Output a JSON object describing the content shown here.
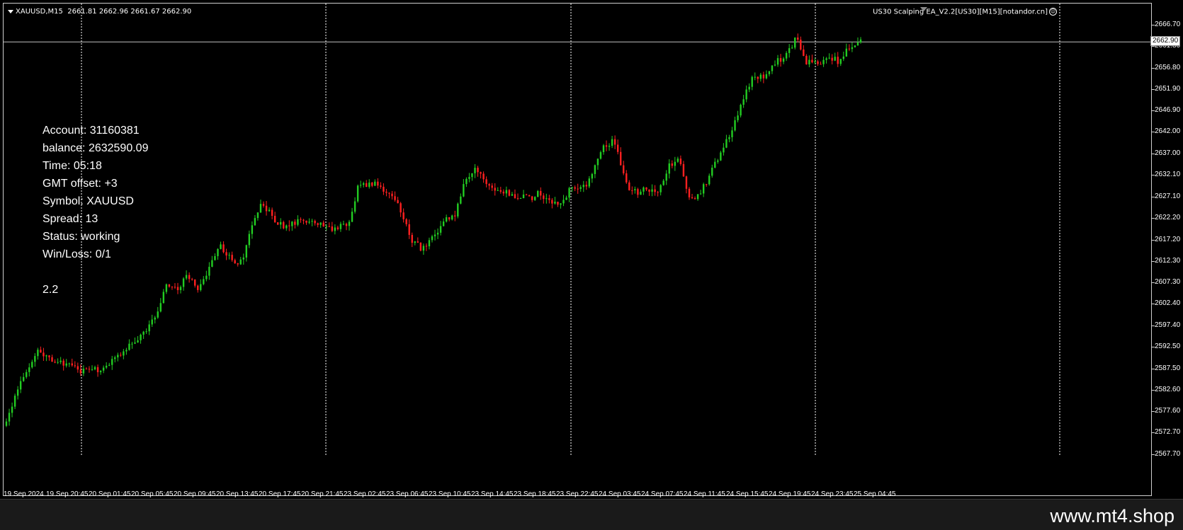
{
  "header": {
    "symbol_tf": "XAUUSD,M15",
    "ohlc": "2661.81 2662.96 2661.67 2662.90"
  },
  "ea": {
    "label": "US30 Scalping EA_V2.2[US30][M15][notandor.cn]",
    "icon": "smiley-icon"
  },
  "info_panel": {
    "lines": [
      "Account: 31160381",
      "balance: 2632590.09",
      "Time: 05:18",
      "GMT offset: +3",
      "Symbol: XAUUSD",
      "Spread: 13",
      "Status: working",
      "Win/Loss: 0/1"
    ],
    "version": "2.2"
  },
  "price_axis": {
    "labels": [
      "2666.70",
      "2661.80",
      "2656.80",
      "2651.90",
      "2646.90",
      "2642.00",
      "2637.00",
      "2632.10",
      "2627.10",
      "2622.20",
      "2617.20",
      "2612.30",
      "2607.30",
      "2602.40",
      "2597.40",
      "2592.50",
      "2587.50",
      "2582.60",
      "2577.60",
      "2572.70",
      "2567.70"
    ],
    "current": "2662.90"
  },
  "time_axis": {
    "labels": [
      "19 Sep 2024",
      "19 Sep 20:45",
      "20 Sep 01:45",
      "20 Sep 05:45",
      "20 Sep 09:45",
      "20 Sep 13:45",
      "20 Sep 17:45",
      "20 Sep 21:45",
      "23 Sep 02:45",
      "23 Sep 06:45",
      "23 Sep 10:45",
      "23 Sep 14:45",
      "23 Sep 18:45",
      "23 Sep 22:45",
      "24 Sep 03:45",
      "24 Sep 07:45",
      "24 Sep 11:45",
      "24 Sep 15:45",
      "24 Sep 19:45",
      "24 Sep 23:45",
      "25 Sep 04:45"
    ]
  },
  "watermark": "www.mt4.shop",
  "colors": {
    "background": "#000000",
    "bull": "#22cc22",
    "bear": "#ff2020",
    "grid": "#ffffff",
    "bid_line": "#bfbfbf"
  },
  "chart_data": {
    "type": "candlestick",
    "symbol": "XAUUSD",
    "timeframe": "M15",
    "ylim": [
      2567.7,
      2666.7
    ],
    "y_ticks": [
      2666.7,
      2661.8,
      2656.8,
      2651.9,
      2646.9,
      2642.0,
      2637.0,
      2632.1,
      2627.1,
      2622.2,
      2617.2,
      2612.3,
      2607.3,
      2602.4,
      2597.4,
      2592.5,
      2587.5,
      2582.6,
      2577.6,
      2572.7,
      2567.7
    ],
    "bid": 2662.9,
    "close_path": [
      2575,
      2583,
      2588,
      2592,
      2590,
      2589,
      2588,
      2587,
      2588,
      2587,
      2590,
      2592,
      2594,
      2596,
      2600,
      2607,
      2606,
      2609,
      2606,
      2611,
      2616,
      2613,
      2612,
      2621,
      2626,
      2622,
      2620,
      2621,
      2622,
      2621,
      2620,
      2620,
      2621,
      2630,
      2630,
      2630,
      2627,
      2624,
      2617,
      2615,
      2618,
      2622,
      2623,
      2631,
      2634,
      2630,
      2628,
      2628,
      2627,
      2627,
      2628,
      2626,
      2626,
      2630,
      2629,
      2633,
      2639,
      2640,
      2630,
      2628,
      2629,
      2629,
      2634,
      2636,
      2626,
      2628,
      2633,
      2638,
      2643,
      2650,
      2655,
      2655,
      2658,
      2660,
      2664,
      2658,
      2658,
      2660,
      2658,
      2662,
      2663
    ],
    "grid_times": [
      "19 Sep 20:45",
      "20 Sep 21:45",
      "23 Sep 22:45",
      "24 Sep 23:45"
    ]
  }
}
